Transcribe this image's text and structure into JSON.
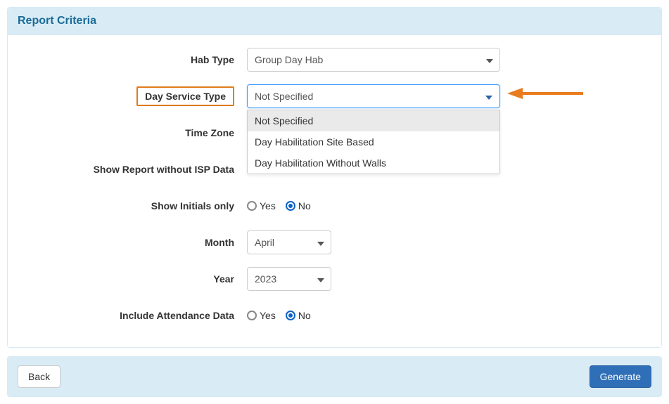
{
  "panel": {
    "title": "Report Criteria"
  },
  "labels": {
    "habType": "Hab Type",
    "dayServiceType": "Day Service Type",
    "timeZone": "Time Zone",
    "showWithoutIsp": "Show Report without ISP Data",
    "showInitials": "Show Initials only",
    "month": "Month",
    "year": "Year",
    "includeAttendance": "Include Attendance Data"
  },
  "habType": {
    "value": "Group Day Hab"
  },
  "dayServiceType": {
    "value": "Not Specified",
    "options": [
      "Not Specified",
      "Day Habilitation Site Based",
      "Day Habilitation Without Walls"
    ]
  },
  "radio": {
    "yes": "Yes",
    "no": "No"
  },
  "showInitials": {
    "selected": "No"
  },
  "includeAttendance": {
    "selected": "No"
  },
  "month": {
    "value": "April"
  },
  "year": {
    "value": "2023"
  },
  "footer": {
    "back": "Back",
    "generate": "Generate"
  }
}
